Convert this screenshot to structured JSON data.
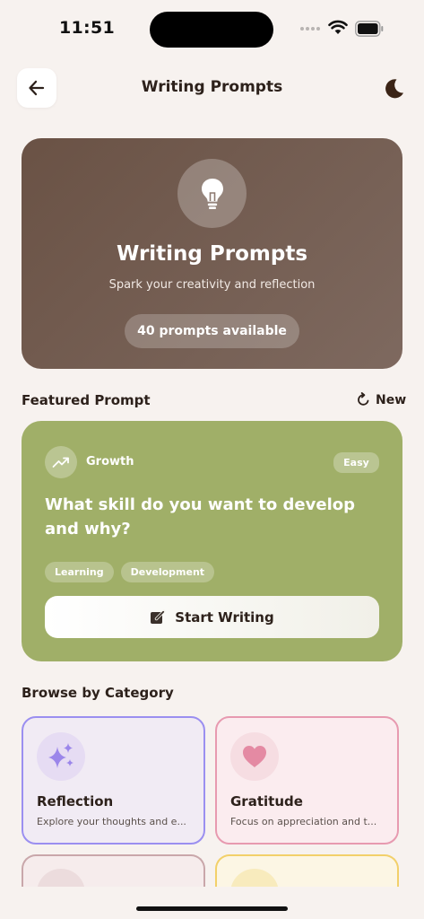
{
  "status_bar": {
    "time": "11:51"
  },
  "header": {
    "title": "Writing Prompts"
  },
  "hero": {
    "title": "Writing Prompts",
    "subtitle": "Spark your creativity and reflection",
    "badge": "40 prompts available"
  },
  "featured": {
    "section_title": "Featured Prompt",
    "new_label": "New",
    "category": "Growth",
    "difficulty": "Easy",
    "prompt": "What skill do you want to develop and why?",
    "tags": [
      "Learning",
      "Development"
    ],
    "start_label": "Start Writing"
  },
  "browse": {
    "section_title": "Browse by Category",
    "categories": [
      {
        "name": "Reflection",
        "description": "Explore your thoughts and e...",
        "icon": "sparkles-icon",
        "color": "#9b8ff0"
      },
      {
        "name": "Gratitude",
        "description": "Focus on appreciation and t...",
        "icon": "heart-icon",
        "color": "#e79ab0"
      }
    ]
  },
  "colors": {
    "background": "#f7f2ef",
    "hero": "#6a5245",
    "featured": "#a0af68",
    "reflection_border": "#9b8ff0",
    "gratitude_border": "#e79ab0"
  }
}
